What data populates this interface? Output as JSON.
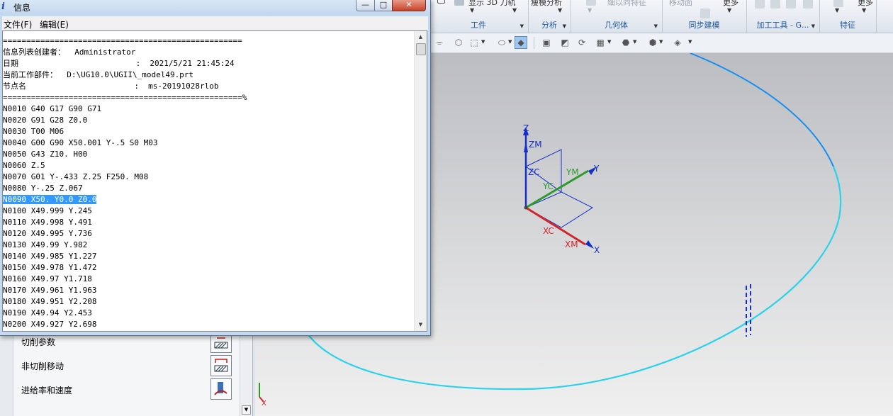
{
  "info_window": {
    "title": "信息",
    "icon": "info-icon",
    "buttons": {
      "minimize": "—",
      "maximize": "□",
      "close": "✕"
    },
    "menu": [
      "文件(F)",
      "编辑(E)"
    ],
    "lines": [
      "===================================================",
      "信息列表创建者：  Administrator",
      "日期                         :  2021/5/21 21:45:24",
      "当前工作部件：  D:\\UG10.0\\UGII\\_model49.prt",
      "节点名                       :  ms-20191028rlob",
      "===================================================%",
      "N0010 G40 G17 G90 G71",
      "N0020 G91 G28 Z0.0",
      "N0030 T00 M06",
      "N0040 G00 G90 X50.001 Y-.5 S0 M03",
      "N0050 G43 Z10. H00",
      "N0060 Z.5",
      "N0070 G01 Y-.433 Z.25 F250. M08",
      "N0080 Y-.25 Z.067",
      "N0090 X50. Y0.0 Z0.0",
      "N0100 X49.999 Y.245",
      "N0110 X49.998 Y.491",
      "N0120 X49.995 Y.736",
      "N0130 X49.99 Y.982",
      "N0140 X49.985 Y1.227",
      "N0150 X49.978 Y1.472",
      "N0160 X49.97 Y1.718",
      "N0170 X49.961 Y1.963",
      "N0180 X49.951 Y2.208",
      "N0190 X49.94 Y2.453",
      "N0200 X49.927 Y2.698"
    ],
    "selected_line_index": 14
  },
  "ribbon": {
    "top_labels": [
      "显示 3D 刀轨",
      "瘦模分析",
      "细以同特征",
      "移动面",
      "更多",
      "更多"
    ],
    "groups": [
      "工件",
      "分析",
      "几何体",
      "同步建模",
      "加工工具 - G...",
      "特征"
    ]
  },
  "nav_panel": {
    "rows": [
      "切削参数",
      "非切削移动",
      "进给率和速度"
    ]
  },
  "viewport": {
    "triad_labels": [
      "Z",
      "ZM",
      "ZC",
      "YM",
      "Y",
      "YC",
      "XC",
      "XM",
      "X"
    ],
    "colors": {
      "z": "#1530c8",
      "y": "#2e9a2e",
      "x": "#d0262a",
      "toolpath": "#2ad2ea",
      "background_top": "#bcbdc1",
      "background_bottom": "#f0f0f0"
    }
  }
}
